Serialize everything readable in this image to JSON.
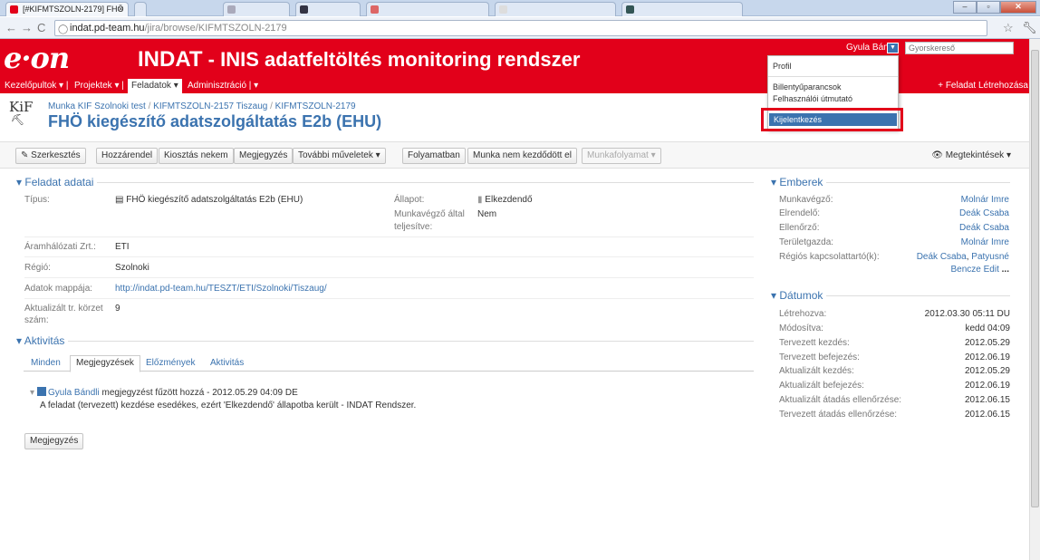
{
  "browser": {
    "tabs": [
      {
        "label": "[#KIFMTSZOLN-2179] FHÖ",
        "active": true
      },
      {
        "label": "",
        "active": false
      },
      {
        "label": "",
        "active": false
      },
      {
        "label": "",
        "active": false
      },
      {
        "label": "",
        "active": false
      },
      {
        "label": "",
        "active": false
      }
    ],
    "url_host": "indat.pd-team.hu",
    "url_path": "/jira/browse/KIFMTSZOLN-2179"
  },
  "header": {
    "logo": "e·on",
    "title": "INDAT",
    "title_separator": " - ",
    "subtitle": "INIS adatfeltöltés monitoring rendszer",
    "user": "Gyula Bándli",
    "quick_search_placeholder": "Gyorskereső",
    "nav": [
      {
        "label": "Kezelőpultok",
        "active": false
      },
      {
        "label": "Projektek",
        "active": false
      },
      {
        "label": "Feladatok",
        "active": true
      },
      {
        "label": "Adminisztráció",
        "active": false
      }
    ],
    "create_label": "+ Feladat Létrehozása"
  },
  "user_menu": {
    "items": [
      "Profil",
      "Billentyűparancsok",
      "Felhasználói útmutató",
      "Kijelentkezés"
    ],
    "highlighted": "Kijelentkezés"
  },
  "issue": {
    "project_avatar_text": "KiF",
    "breadcrumbs": [
      "Munka KIF Szolnoki test",
      "KIFMTSZOLN-2157 Tiszaug",
      "KIFMTSZOLN-2179"
    ],
    "title": "FHÖ kiegészítő adatszolgáltatás E2b (EHU)"
  },
  "toolbar": {
    "edit": "Szerkesztés",
    "assign": "Hozzárendel",
    "assign_me": "Kiosztás nekem",
    "comment": "Megjegyzés",
    "more": "További műveletek",
    "in_progress": "Folyamatban",
    "not_started": "Munka nem kezdődött el",
    "workflow": "Munkafolyamat",
    "watchers": "Megtekintések"
  },
  "details": {
    "heading": "Feladat adatai",
    "type_label": "Típus:",
    "type_value": "FHÖ kiegészítő adatszolgáltatás E2b (EHU)",
    "status_label": "Állapot:",
    "status_value": "Elkezdendő",
    "done_label_1": "Munkavégző által",
    "done_label_2": "teljesítve:",
    "done_value": "Nem",
    "fields": [
      {
        "label": "Áramhálózati Zrt.:",
        "value": "ETI"
      },
      {
        "label": "Régió:",
        "value": "Szolnoki"
      },
      {
        "label": "Adatok mappája:",
        "value": "http://indat.pd-team.hu/TESZT/ETI/Szolnoki/Tiszaug/"
      },
      {
        "label_1": "Aktualizált tr. körzet",
        "label_2": "szám:",
        "value": "9"
      }
    ]
  },
  "activity": {
    "heading": "Aktivitás",
    "tabs": [
      {
        "label": "Minden",
        "active": false
      },
      {
        "label": "Megjegyzések",
        "active": true
      },
      {
        "label": "Előzmények",
        "active": false
      },
      {
        "label": "Aktivitás",
        "active": false
      }
    ],
    "comment_author": "Gyula Bándli",
    "comment_meta": " megjegyzést fűzött hozzá - 2012.05.29 04:09 DE",
    "comment_text": "A feladat (tervezett) kezdése esedékes, ezért 'Elkezdendő' állapotba került - INDAT Rendszer.",
    "comment_button": "Megjegyzés"
  },
  "people": {
    "heading": "Emberek",
    "rows": [
      {
        "label": "Munkavégző:",
        "value": "Molnár Imre"
      },
      {
        "label": "Elrendelő:",
        "value": "Deák Csaba"
      },
      {
        "label": "Ellenőrző:",
        "value": "Deák Csaba"
      },
      {
        "label": "Területgazda:",
        "value": "Molnár Imre"
      },
      {
        "label": "Régiós kapcsolattartó(k):",
        "value_1": "Deák Csaba",
        "value_sep": ", ",
        "value_2": "Patyusné",
        "value_3": "Bencze Edit",
        "more": " ..."
      }
    ]
  },
  "dates": {
    "heading": "Dátumok",
    "rows": [
      {
        "label": "Létrehozva:",
        "value": "2012.03.30 05:11 DU"
      },
      {
        "label": "Módosítva:",
        "value": "kedd 04:09"
      },
      {
        "label": "Tervezett kezdés:",
        "value": "2012.05.29"
      },
      {
        "label": "Tervezett befejezés:",
        "value": "2012.06.19"
      },
      {
        "label": "Aktualizált kezdés:",
        "value": "2012.05.29"
      },
      {
        "label": "Aktualizált befejezés:",
        "value": "2012.06.19"
      },
      {
        "label": "Aktualizált átadás ellenőrzése:",
        "value": "2012.06.15"
      },
      {
        "label": "Tervezett átadás ellenőrzése:",
        "value": "2012.06.15"
      }
    ]
  },
  "colors": {
    "brand_red": "#e2001a",
    "link_blue": "#3b73af"
  }
}
